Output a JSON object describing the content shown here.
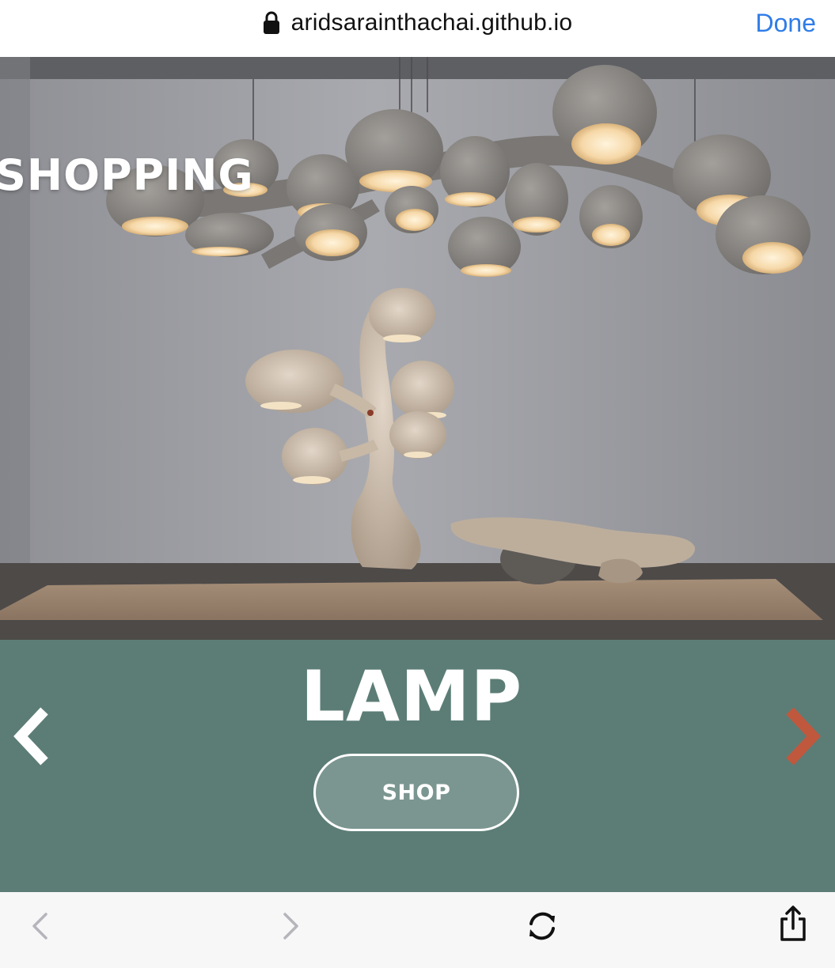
{
  "browser": {
    "url": "aridsarainthachai.github.io",
    "done_label": "Done",
    "url_icon": "lock-icon"
  },
  "hero": {
    "brand_logo": "SHOPPING",
    "image_subject": "sculptural pendant lamps and floor lamp"
  },
  "slide": {
    "title": "LAMP",
    "shop_label": "SHOP",
    "prev_icon": "chevron-left-icon",
    "next_icon": "chevron-right-icon"
  },
  "toolbar": {
    "items": [
      "back-icon",
      "forward-icon",
      "reload-icon",
      "share-icon"
    ]
  },
  "colors": {
    "panel": "#5c7d76",
    "shop_button": "#7b9690",
    "next_arrow": "#c0583e",
    "link": "#2f7ce8"
  }
}
